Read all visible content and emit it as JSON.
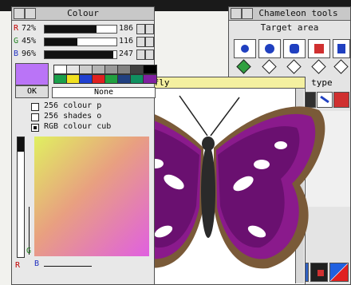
{
  "colour_window": {
    "title": "Colour",
    "channels": [
      {
        "letter": "R",
        "percent": "72%",
        "value": "186",
        "fraction": 0.72,
        "color": "#c00000"
      },
      {
        "letter": "G",
        "percent": "45%",
        "value": "116",
        "fraction": 0.45,
        "color": "#208020"
      },
      {
        "letter": "B",
        "percent": "96%",
        "value": "247",
        "fraction": 0.96,
        "color": "#2030c0"
      }
    ],
    "ok_label": "OK",
    "none_label": "None",
    "palette_top": [
      "#ffffff",
      "#e6e6e6",
      "#cccccc",
      "#b3b3b3",
      "#999999",
      "#808080",
      "#404040",
      "#000000"
    ],
    "palette_bottom": [
      "#1aa04a",
      "#f0e020",
      "#2040d0",
      "#e02020",
      "#20a040",
      "#204080",
      "#109060",
      "#8020a0"
    ],
    "options": [
      {
        "label": "256 colour p",
        "checked": false
      },
      {
        "label": "256 shades o",
        "checked": false
      },
      {
        "label": "RGB colour cub",
        "checked": true
      }
    ],
    "axis_g": "G",
    "axis_r": "R",
    "axis_b": "B"
  },
  "chameleon_window": {
    "title": "Chameleon tools",
    "target_area_label": "Target area",
    "action_type_label": "tion type"
  },
  "image_window": {
    "title_fragment": "rfly"
  }
}
